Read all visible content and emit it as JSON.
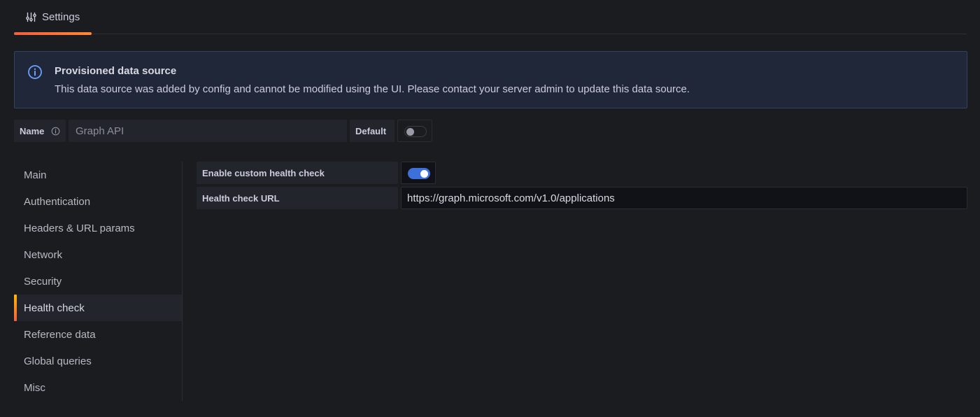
{
  "tabs": [
    {
      "label": "Settings",
      "icon": "sliders-icon",
      "active": true
    }
  ],
  "alert": {
    "icon": "info-circle-icon",
    "title": "Provisioned data source",
    "message": "This data source was added by config and cannot be modified using the UI. Please contact your server admin to update this data source."
  },
  "name_row": {
    "name_label": "Name",
    "name_value": "Graph API",
    "default_label": "Default",
    "default_enabled": false
  },
  "sidebar": {
    "items": [
      {
        "label": "Main",
        "active": false
      },
      {
        "label": "Authentication",
        "active": false
      },
      {
        "label": "Headers & URL params",
        "active": false
      },
      {
        "label": "Network",
        "active": false
      },
      {
        "label": "Security",
        "active": false
      },
      {
        "label": "Health check",
        "active": true
      },
      {
        "label": "Reference data",
        "active": false
      },
      {
        "label": "Global queries",
        "active": false
      },
      {
        "label": "Misc",
        "active": false
      }
    ]
  },
  "health_check": {
    "enable_label": "Enable custom health check",
    "enabled": true,
    "url_label": "Health check URL",
    "url_value": "https://graph.microsoft.com/v1.0/applications"
  },
  "colors": {
    "accent_gradient_start": "#f55f3e",
    "accent_gradient_end": "#ff8833",
    "info_blue": "#6e9fff",
    "toggle_on": "#3d71d9",
    "alert_bg": "#1f2739",
    "background": "#1b1c20"
  }
}
